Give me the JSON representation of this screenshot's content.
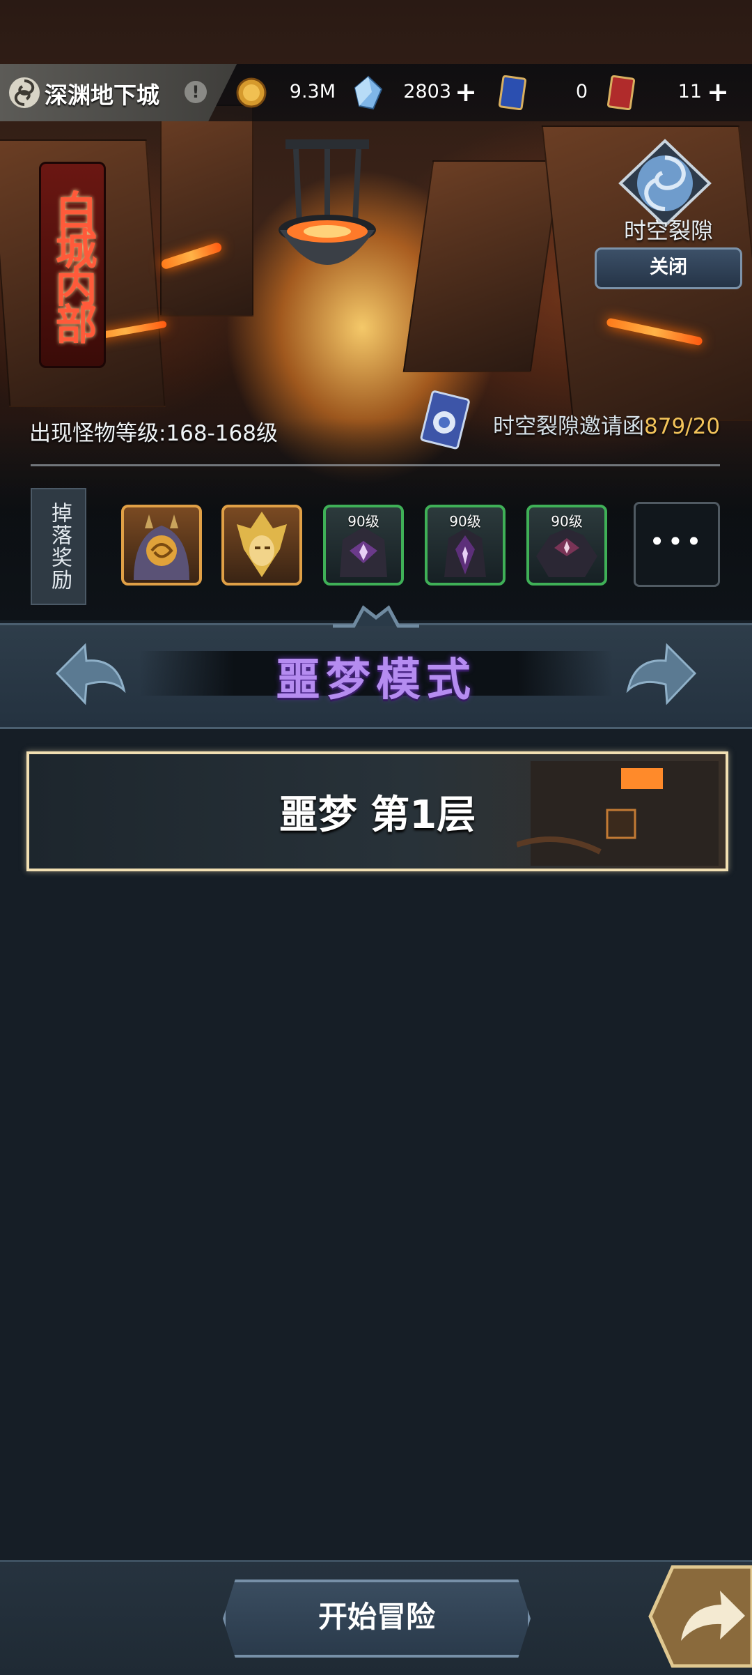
{
  "header": {
    "dungeon_title": "深渊地下城",
    "info_symbol": "!",
    "resources": [
      {
        "name": "gold-coin-icon",
        "value": "9.3M"
      },
      {
        "name": "crystal-icon",
        "value": "2803"
      },
      {
        "name": "blue-card-icon",
        "value": "0"
      },
      {
        "name": "red-card-icon",
        "value": "11"
      }
    ],
    "plus_symbol": "+"
  },
  "area": {
    "title": "白城内部",
    "monster_level": "出现怪物等级:168-168级"
  },
  "rift": {
    "label": "时空裂隙",
    "close_label": "关闭",
    "invite_label": "时空裂隙邀请函",
    "invite_count": "879/20"
  },
  "drops": {
    "label": "掉落奖励",
    "items": [
      {
        "icon": "hooded-monster-icon",
        "level": ""
      },
      {
        "icon": "golden-warrior-icon",
        "level": ""
      },
      {
        "icon": "dark-armor-icon",
        "level": "90级"
      },
      {
        "icon": "dark-armor-icon",
        "level": "90级"
      },
      {
        "icon": "dark-armor-icon",
        "level": "90级"
      }
    ],
    "more": "•••"
  },
  "mode": {
    "title": "噩梦模式"
  },
  "floors": [
    {
      "label": "噩梦 第1层"
    }
  ],
  "footer": {
    "start_label": "开始冒险"
  },
  "colors": {
    "mode_title": "#b58cf0",
    "invite_count": "#f2c35a",
    "selected_border": "#f1dfb2"
  }
}
